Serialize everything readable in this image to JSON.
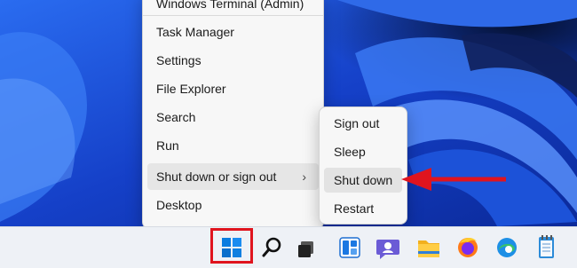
{
  "context_menu": {
    "items": [
      {
        "label": "Windows Terminal (Admin)"
      },
      {
        "label": "Task Manager"
      },
      {
        "label": "Settings"
      },
      {
        "label": "File Explorer"
      },
      {
        "label": "Search"
      },
      {
        "label": "Run"
      },
      {
        "label": "Shut down or sign out",
        "chevron": "›"
      },
      {
        "label": "Desktop"
      }
    ]
  },
  "submenu": {
    "items": [
      {
        "label": "Sign out"
      },
      {
        "label": "Sleep"
      },
      {
        "label": "Shut down"
      },
      {
        "label": "Restart"
      }
    ]
  },
  "taskbar": {
    "icons": [
      "windows-start-icon",
      "search-icon",
      "task-view-icon",
      "widgets-icon",
      "teams-chat-icon",
      "file-explorer-icon",
      "firefox-icon",
      "edge-icon",
      "notepad-icon"
    ]
  },
  "colors": {
    "highlight_box": "#e0141e",
    "arrow": "#e0141e",
    "wallpaper": "#1f4fd8",
    "taskbar": "#eef1f6"
  }
}
